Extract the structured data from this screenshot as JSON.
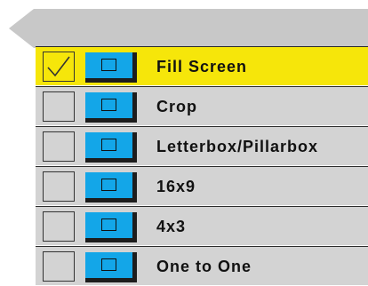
{
  "menu": {
    "items": [
      {
        "label": "Fill Screen",
        "checked": true,
        "selected": true,
        "icon": "aspect-ratio-icon"
      },
      {
        "label": "Crop",
        "checked": false,
        "selected": false,
        "icon": "aspect-ratio-icon"
      },
      {
        "label": "Letterbox/Pillarbox",
        "checked": false,
        "selected": false,
        "icon": "aspect-ratio-icon"
      },
      {
        "label": "16x9",
        "checked": false,
        "selected": false,
        "icon": "aspect-ratio-icon"
      },
      {
        "label": "4x3",
        "checked": false,
        "selected": false,
        "icon": "aspect-ratio-icon"
      },
      {
        "label": "One to One",
        "checked": false,
        "selected": false,
        "icon": "aspect-ratio-icon"
      }
    ]
  },
  "colors": {
    "item_background": "#d3d3d3",
    "selected_background": "#f6e60a",
    "icon_screen": "#13a6e8",
    "icon_shadow": "#1d1d1d",
    "header_background": "#c8c8c8"
  }
}
